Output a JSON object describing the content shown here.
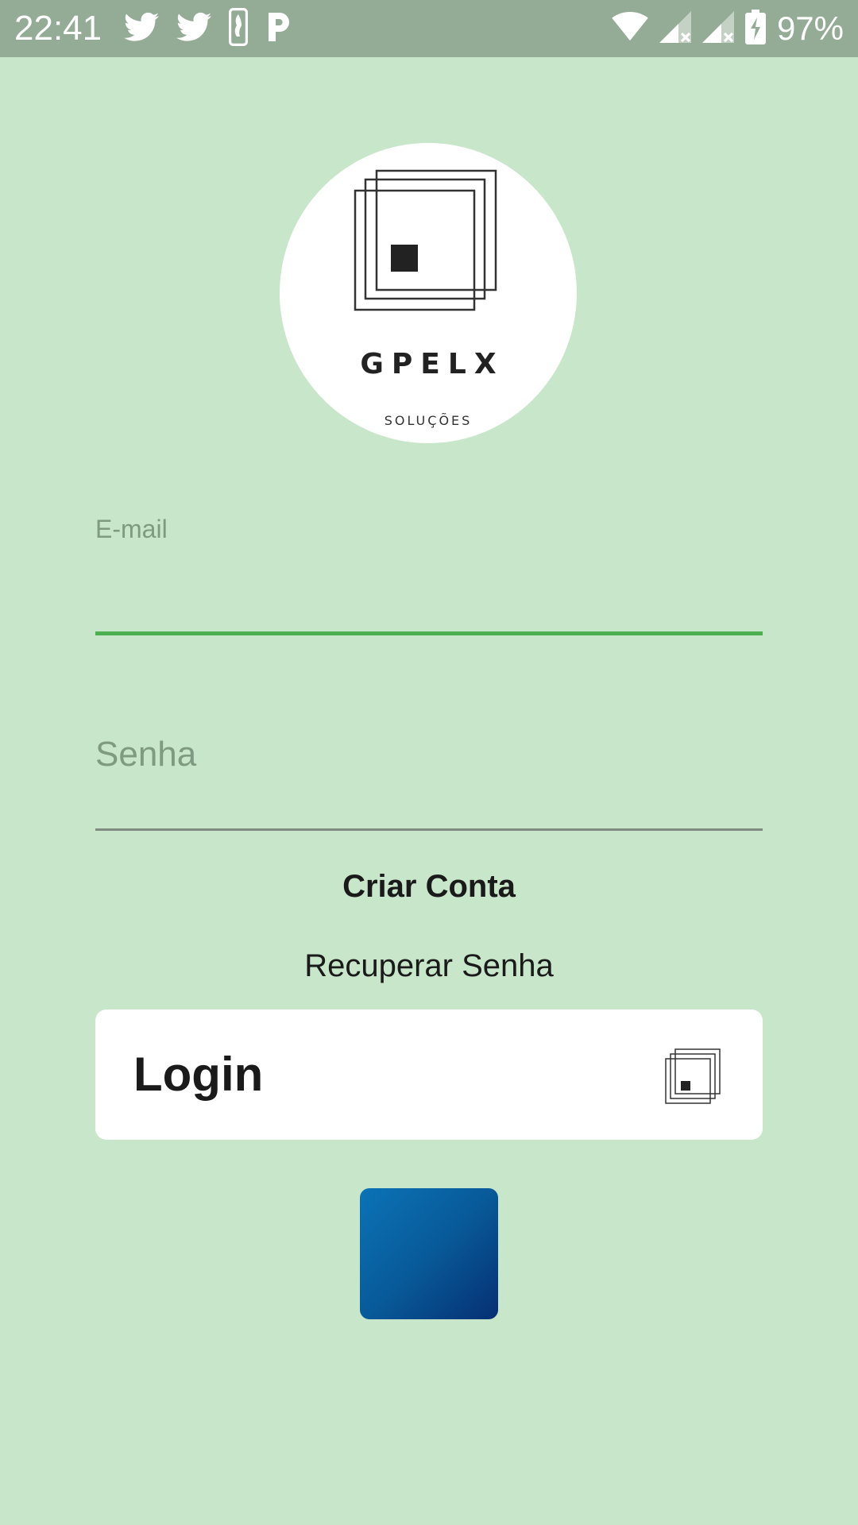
{
  "status_bar": {
    "time": "22:41",
    "notification_icons": [
      "twitter-icon",
      "twitter-icon",
      "nba-icon",
      "p-app-icon"
    ],
    "system_icons": [
      "wifi-icon",
      "signal-icon",
      "signal-icon",
      "battery-icon"
    ],
    "battery_percent": "97%"
  },
  "logo": {
    "name": "GPELX",
    "subtitle": "SOLUÇÕES"
  },
  "form": {
    "email_label": "E-mail",
    "email_value": "",
    "password_placeholder": "Senha",
    "password_value": ""
  },
  "links": {
    "create_account": "Criar Conta",
    "recover_password": "Recuperar Senha"
  },
  "login_button": {
    "label": "Login"
  },
  "colors": {
    "background": "#c8e6c9",
    "status_bar": "#94ab96",
    "accent": "#4caf50",
    "blue_button_start": "#0b73b6",
    "blue_button_end": "#063073"
  }
}
